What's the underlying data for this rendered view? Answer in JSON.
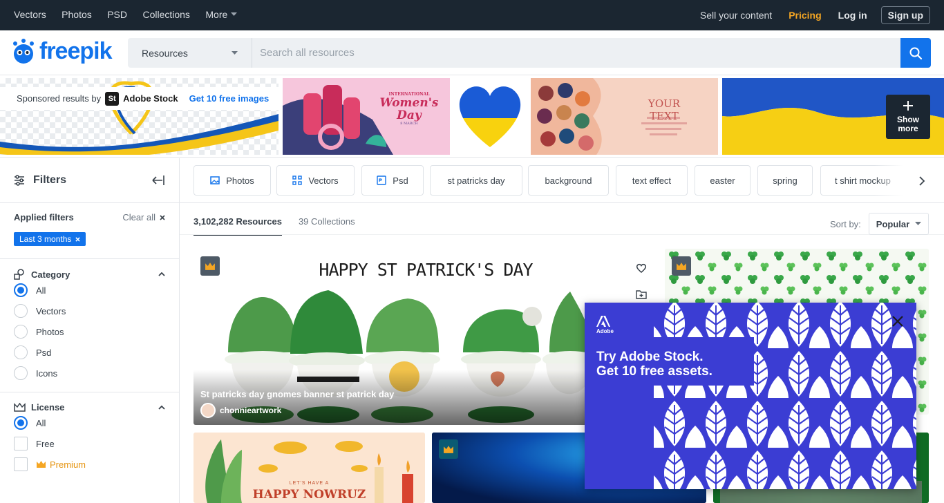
{
  "topnav": {
    "items": [
      "Vectors",
      "Photos",
      "PSD",
      "Collections",
      "More"
    ],
    "sell": "Sell your content",
    "pricing": "Pricing",
    "login": "Log in",
    "signup": "Sign up"
  },
  "header": {
    "logo": "freepik",
    "resource_select": "Resources",
    "search_placeholder": "Search all resources"
  },
  "sponsored": {
    "label": "Sponsored results by",
    "brand_badge": "St",
    "brand": "Adobe Stock",
    "cta": "Get 10 free images",
    "show_more": "Show more",
    "banner_womens_day_small": "INTERNATIONAL",
    "banner_womens_day": "Women's Day",
    "banner_womens_day_date": "8 MARCH",
    "banner_your_text": "YOUR TEXT"
  },
  "sidebar": {
    "filters_title": "Filters",
    "applied_title": "Applied filters",
    "clear_all": "Clear all",
    "chip": "Last 3 months",
    "category": {
      "title": "Category",
      "options": [
        "All",
        "Vectors",
        "Photos",
        "Psd",
        "Icons"
      ],
      "selected": "All"
    },
    "license": {
      "title": "License",
      "options": [
        "All",
        "Free",
        "Premium"
      ],
      "selected": "All"
    }
  },
  "tags": [
    "Photos",
    "Vectors",
    "Psd",
    "st patricks day",
    "background",
    "text effect",
    "easter",
    "spring",
    "t shirt mockup"
  ],
  "results": {
    "resources_tab": "3,102,282 Resources",
    "collections_tab": "39 Collections",
    "sort_label": "Sort by:",
    "sort_value": "Popular"
  },
  "cards": {
    "main_heading": "HAPPY ST PATRICK'S DAY",
    "main_title": "St patricks day gnomes banner st patrick day",
    "main_author": "chonnieartwork",
    "nowruz_small": "LET'S HAVE A",
    "nowruz": "HAPPY NOWRUZ"
  },
  "popup": {
    "brand": "Adobe",
    "line1": "Try Adobe Stock.",
    "line2": "Get 10 free assets."
  },
  "colors": {
    "accent": "#1273eb",
    "topbar": "#1b2631",
    "pricing": "#f5a623",
    "premium": "#e5930e",
    "popup_bg": "#3b3dd3"
  }
}
